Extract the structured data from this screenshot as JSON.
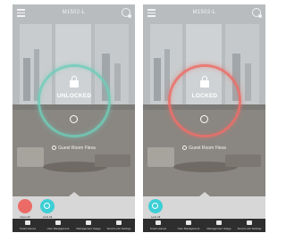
{
  "screens": [
    {
      "title": "M1502-L",
      "state_label": "UNLOCKED",
      "room_label": "Guest Room Flexa",
      "ring_color": "#6ecdb9",
      "tray_buttons": [
        {
          "label": "Open All",
          "color": "#ec6b66"
        },
        {
          "label": "Lock All",
          "color": "#3ccfd6"
        }
      ]
    },
    {
      "title": "M1502-L",
      "state_label": "LOCKED",
      "room_label": "Guest Room Flexa",
      "ring_color": "#ec6e68",
      "tray_buttons": [
        {
          "label": "Lock All",
          "color": "#3ccfd6"
        }
      ]
    }
  ],
  "nav": [
    {
      "label": "Smart Homes"
    },
    {
      "label": "User Management"
    },
    {
      "label": "Management Usage"
    },
    {
      "label": "Smart Lock Settings"
    }
  ]
}
